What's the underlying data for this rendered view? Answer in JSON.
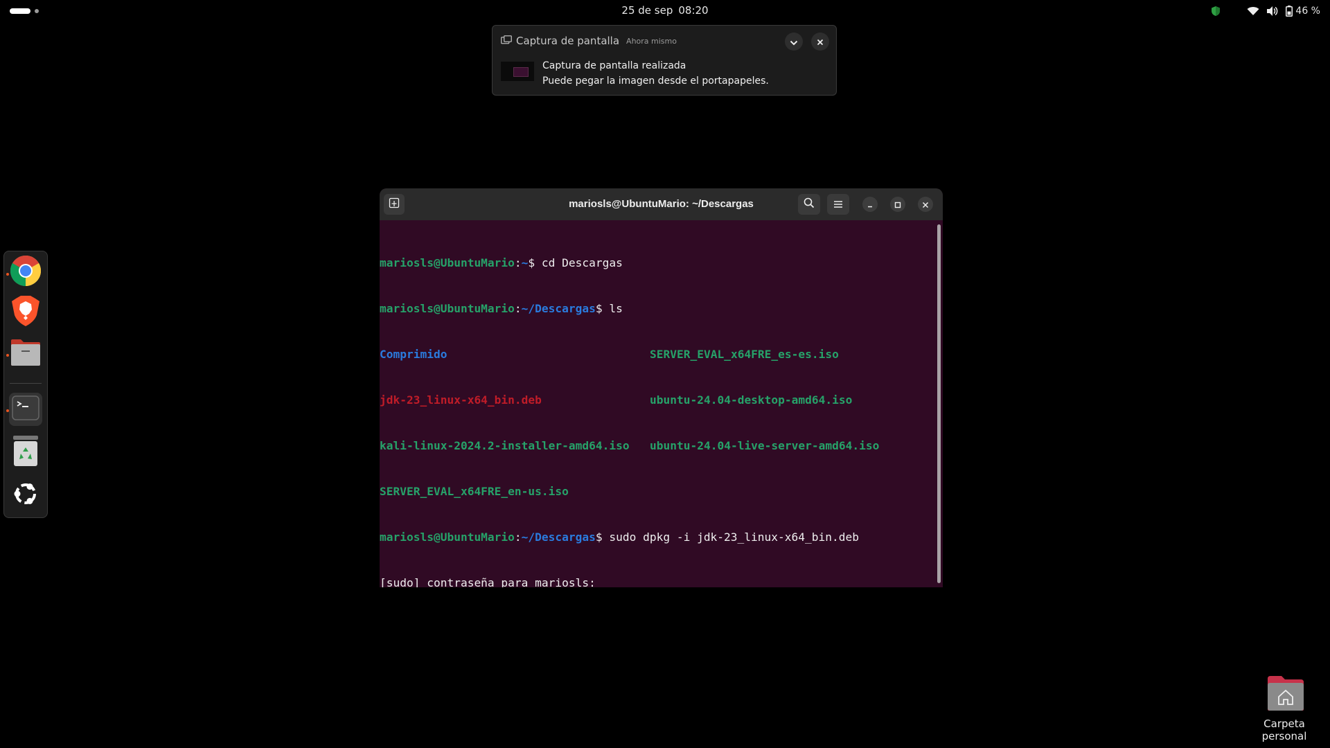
{
  "topbar": {
    "date": "25 de sep",
    "time": "08:20",
    "battery": "46 %",
    "icons": [
      "shield-icon",
      "wifi-icon",
      "volume-icon",
      "battery-icon"
    ]
  },
  "notification": {
    "app": "Captura de pantalla",
    "time": "Ahora mismo",
    "title": "Captura de pantalla realizada",
    "body": "Puede pegar la imagen desde el portapapeles."
  },
  "dock": {
    "items": [
      "chrome-icon",
      "brave-icon",
      "files-icon",
      "terminal-icon",
      "trash-icon",
      "ubuntu-apps-icon"
    ]
  },
  "terminal": {
    "title": "mariosls@UbuntuMario: ~/Descargas",
    "user": "mariosls@UbuntuMario",
    "sep": ":",
    "home_path": "~",
    "dl_path": "~/Descargas",
    "prompt": "$ ",
    "cmd1": "cd Descargas",
    "cmd2": "ls",
    "cmd3": "sudo dpkg -i jdk-23_linux-x64_bin.deb",
    "ls_col1": [
      "Comprimido",
      "jdk-23_linux-x64_bin.deb",
      "kali-linux-2024.2-installer-amd64.iso",
      "SERVER_EVAL_x64FRE_en-us.iso"
    ],
    "ls_col2": [
      "SERVER_EVAL_x64FRE_es-es.iso",
      "ubuntu-24.04-desktop-amd64.iso",
      "ubuntu-24.04-live-server-amd64.iso"
    ],
    "sudo_prompt": "[sudo] contraseña para mariosls:"
  },
  "desktop": {
    "home_label": "Carpeta personal"
  },
  "colors": {
    "terminal_bg": "#300a24",
    "prompt_user": "#26a269",
    "prompt_path": "#2a7bde",
    "deb_file": "#c01c28",
    "accent": "#e95420"
  }
}
